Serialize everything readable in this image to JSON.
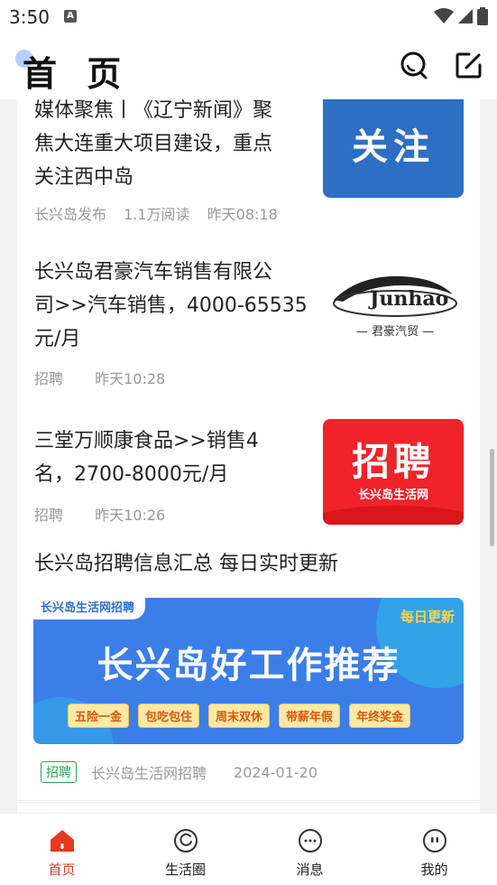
{
  "status": {
    "time": "3:50",
    "notification_glyph": "A"
  },
  "header": {
    "title": "首 页",
    "search_icon": "search-icon",
    "edit_icon": "edit-icon"
  },
  "feed": [
    {
      "title_lines": [
        "媒体聚焦丨《辽宁新闻》聚",
        "焦大连重大项目建设，重点",
        "关注西中岛"
      ],
      "meta": [
        "长兴岛发布",
        "1.1万阅读",
        "昨天08:18"
      ],
      "thumb_text": "关注",
      "thumb_color": "#2d6fc4"
    },
    {
      "title_lines": [
        "长兴岛君豪汽车销售有限公",
        "司>>汽车销售，4000-65535",
        "元/月"
      ],
      "meta": [
        "招聘",
        "昨天10:28"
      ],
      "thumb_logo_text": "Junhao",
      "thumb_logo_sub": "君豪汽贸"
    },
    {
      "title_lines": [
        "三堂万顺康食品>>销售4",
        "名，2700-8000元/月"
      ],
      "meta": [
        "招聘",
        "昨天10:26"
      ],
      "thumb_text": "招聘",
      "thumb_sub": "长兴岛生活网",
      "thumb_color": "#f0222a"
    },
    {
      "title": "长兴岛招聘信息汇总 每日实时更新",
      "banner": {
        "tag": "长兴岛生活网招聘",
        "daily": "每日更新",
        "headline": "长兴岛好工作推荐",
        "chips": [
          "五险一金",
          "包吃包住",
          "周末双休",
          "带薪年假",
          "年终奖金"
        ]
      },
      "badge": "招聘",
      "source": "长兴岛生活网招聘",
      "date": "2024-01-20"
    }
  ],
  "tabs": [
    {
      "label": "首页",
      "icon": "home-icon",
      "active": true
    },
    {
      "label": "生活圈",
      "icon": "circle-icon",
      "active": false
    },
    {
      "label": "消息",
      "icon": "message-icon",
      "active": false
    },
    {
      "label": "我的",
      "icon": "profile-icon",
      "active": false
    }
  ],
  "colors": {
    "accent": "#e8381d",
    "badge_green": "#2da44e",
    "banner_blue": "#3b7ee8"
  }
}
